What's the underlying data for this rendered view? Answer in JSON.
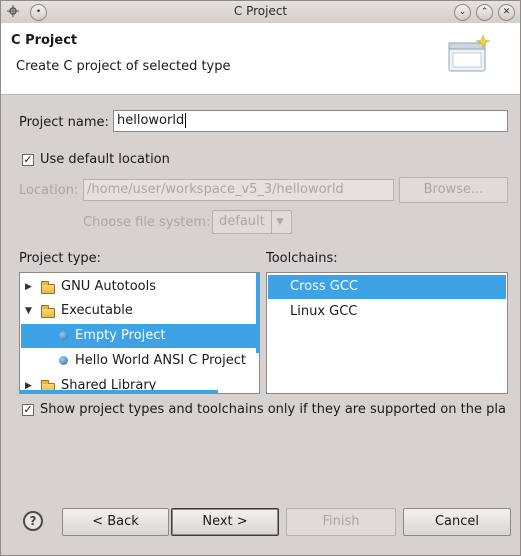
{
  "window": {
    "title": "C Project",
    "buttons": {
      "minimize": "⌄",
      "maximize": "⌃",
      "close": "✕"
    }
  },
  "header": {
    "title": "C Project",
    "subtitle": "Create C project of selected type",
    "icon": "wizard-banner-icon"
  },
  "form": {
    "project_name_label": "Project name:",
    "project_name_value": "helloworld",
    "use_default_location_label": "Use default location",
    "use_default_location_checked": true,
    "location_label": "Location:",
    "location_value": "/home/user/workspace_v5_3/helloworld",
    "browse_label": "Browse...",
    "file_system_label": "Choose file system:",
    "file_system_value": "default"
  },
  "project_type": {
    "label": "Project type:",
    "items": [
      {
        "label": "GNU Autotools",
        "kind": "folder",
        "expanded": false,
        "indent": 0
      },
      {
        "label": "Executable",
        "kind": "folder",
        "expanded": true,
        "indent": 0
      },
      {
        "label": "Empty Project",
        "kind": "item",
        "indent": 1,
        "selected": true
      },
      {
        "label": "Hello World ANSI C Project",
        "kind": "item",
        "indent": 1
      },
      {
        "label": "Shared Library",
        "kind": "folder",
        "expanded": false,
        "indent": 0
      }
    ]
  },
  "toolchains": {
    "label": "Toolchains:",
    "items": [
      {
        "label": "Cross GCC",
        "selected": true
      },
      {
        "label": "Linux GCC",
        "selected": false
      }
    ]
  },
  "filter": {
    "label": "Show project types and toolchains only if they are supported on the platfc",
    "checked": true
  },
  "buttons": {
    "help": "?",
    "back": "< Back",
    "next": "Next >",
    "finish": "Finish",
    "cancel": "Cancel"
  },
  "colors": {
    "selection": "#3da3e6",
    "dialog_bg": "#d6d2d0",
    "header_bg": "#ffffff"
  }
}
